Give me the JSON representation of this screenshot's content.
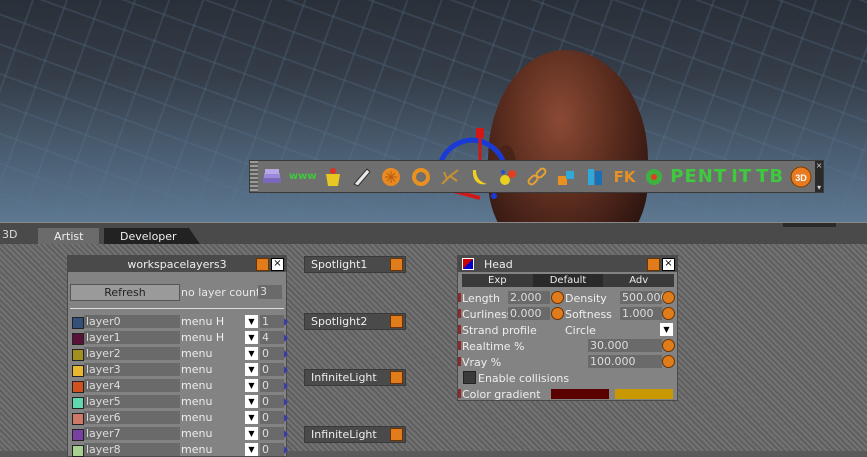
{
  "viewport": {
    "label_3d": "3D"
  },
  "toolbar": {
    "text_tools": [
      "PENT",
      "IT",
      "TB"
    ],
    "fk_label": "FK",
    "www_label": "www"
  },
  "tabs": [
    {
      "label": "Artist",
      "active": true
    },
    {
      "label": "Developer",
      "active": false
    }
  ],
  "workspace_layers": {
    "title": "workspacelayers3",
    "refresh_label": "Refresh",
    "layer_count_label": "no layer count:",
    "layer_count_value": "3",
    "layers": [
      {
        "name": "layer0",
        "menu": "menu H",
        "value": "1",
        "color": "#34507a"
      },
      {
        "name": "layer1",
        "menu": "menu H",
        "value": "4",
        "color": "#5a1038"
      },
      {
        "name": "layer2",
        "menu": "menu",
        "value": "0",
        "color": "#a09020"
      },
      {
        "name": "layer3",
        "menu": "menu",
        "value": "0",
        "color": "#e8b830"
      },
      {
        "name": "layer4",
        "menu": "menu",
        "value": "0",
        "color": "#d05020"
      },
      {
        "name": "layer5",
        "menu": "menu",
        "value": "0",
        "color": "#60d8b0"
      },
      {
        "name": "layer6",
        "menu": "menu",
        "value": "0",
        "color": "#d07868"
      },
      {
        "name": "layer7",
        "menu": "menu",
        "value": "0",
        "color": "#7840a0"
      },
      {
        "name": "layer8",
        "menu": "menu",
        "value": "0",
        "color": "#a8d090"
      }
    ]
  },
  "lights": [
    {
      "label": "Spotlight1"
    },
    {
      "label": "Spotlight2"
    },
    {
      "label": "InfiniteLight"
    },
    {
      "label": "InfiniteLight"
    }
  ],
  "head_panel": {
    "title": "Head",
    "subtabs": [
      "Exp",
      "Default",
      "Adv"
    ],
    "length_label": "Length",
    "length_value": "2.000",
    "density_label": "Density",
    "density_value": "500.000",
    "curliness_label": "Curliness",
    "curliness_value": "0.000",
    "softness_label": "Softness",
    "softness_value": "1.000",
    "strand_label": "Strand profile",
    "strand_value": "Circle",
    "realtime_label": "Realtime %",
    "realtime_value": "30.000",
    "vray_label": "Vray %",
    "vray_value": "100.000",
    "collisions_label": "Enable collisions",
    "gradient_label": "Color gradient",
    "gradient_colors": [
      "#5a0000",
      "#c89800"
    ]
  }
}
